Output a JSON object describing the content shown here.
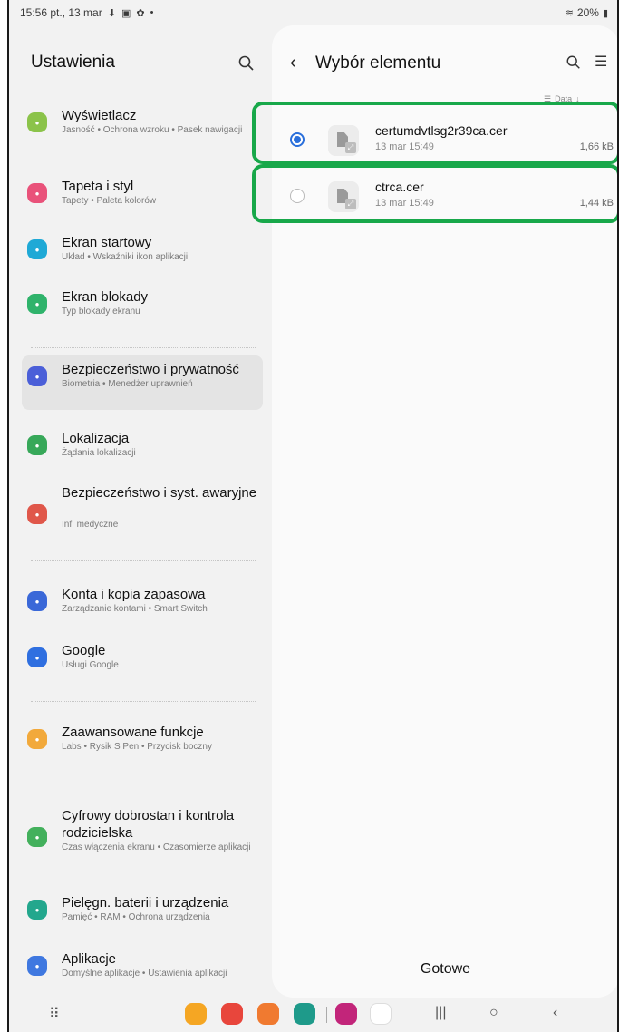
{
  "status_bar": {
    "time_date": "15:56 pt., 13 mar",
    "battery": "20%"
  },
  "settings": {
    "title": "Ustawienia",
    "items": [
      {
        "title": "Wyświetlacz",
        "subtitle": "Jasność • Ochrona wzroku • Pasek nawigacji",
        "color": "#8bc34a",
        "icon": "sun-icon"
      },
      {
        "title": "Tapeta i styl",
        "subtitle": "Tapety • Paleta kolorów",
        "color": "#e9527a",
        "icon": "wallpaper-icon"
      },
      {
        "title": "Ekran startowy",
        "subtitle": "Układ • Wskaźniki ikon aplikacji",
        "color": "#1fa9d6",
        "icon": "home-icon"
      },
      {
        "title": "Ekran blokady",
        "subtitle": "Typ blokady ekranu",
        "color": "#2fb36b",
        "icon": "lock-icon"
      },
      {
        "title": "Bezpieczeństwo i prywatność",
        "subtitle": "Biometria • Menedżer uprawnień",
        "color": "#4b5fd8",
        "icon": "shield-icon"
      },
      {
        "title": "Lokalizacja",
        "subtitle": "Żądania lokalizacji",
        "color": "#37a859",
        "icon": "location-icon"
      },
      {
        "title": "Bezpieczeństwo i syst. awaryjne",
        "subtitle": "Inf. medyczne",
        "color": "#e0574a",
        "icon": "emergency-icon"
      },
      {
        "title": "Konta i kopia zapasowa",
        "subtitle": "Zarządzanie kontami • Smart Switch",
        "color": "#3a68d8",
        "icon": "sync-icon"
      },
      {
        "title": "Google",
        "subtitle": "Usługi Google",
        "color": "#2f6fe0",
        "icon": "google-icon"
      },
      {
        "title": "Zaawansowane funkcje",
        "subtitle": "Labs • Rysik S Pen • Przycisk boczny",
        "color": "#f2a93b",
        "icon": "advanced-features-icon"
      },
      {
        "title": "Cyfrowy dobrostan i kontrola rodzicielska",
        "subtitle": "Czas włączenia ekranu • Czasomierze aplikacji",
        "color": "#43b05c",
        "icon": "wellbeing-icon"
      },
      {
        "title": "Pielęgn. baterii i urządzenia",
        "subtitle": "Pamięć • RAM • Ochrona urządzenia",
        "color": "#23a78d",
        "icon": "battery-care-icon"
      },
      {
        "title": "Aplikacje",
        "subtitle": "Domyślne aplikacje • Ustawienia aplikacji",
        "color": "#3f78e0",
        "icon": "apps-icon"
      }
    ]
  },
  "picker": {
    "title": "Wybór elementu",
    "sort_label": "Data",
    "files": [
      {
        "name": "certumdvtlsg2r39ca.cer",
        "date": "13 mar 15:49",
        "size": "1,66 kB",
        "selected": true
      },
      {
        "name": "ctrca.cer",
        "date": "13 mar 15:49",
        "size": "1,44 kB",
        "selected": false
      }
    ],
    "done_label": "Gotowe"
  },
  "colors": {
    "highlight": "#18a84a",
    "radio_selected": "#2a6fdb"
  }
}
